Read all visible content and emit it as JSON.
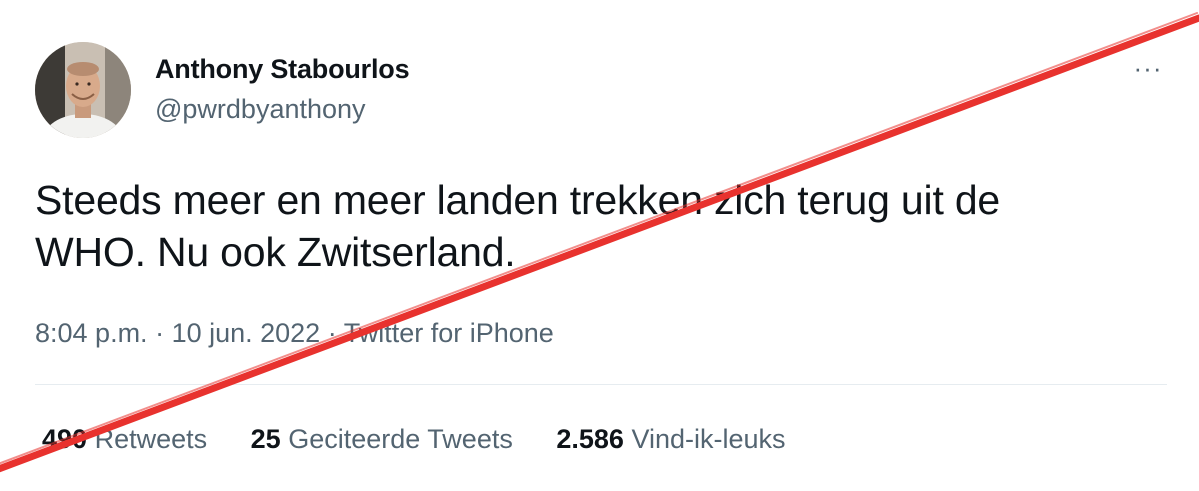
{
  "user": {
    "display_name": "Anthony Stabourlos",
    "handle": "@pwrdbyanthony"
  },
  "more_icon": "···",
  "tweet": {
    "text": "Steeds meer en meer landen trekken zich terug uit de\nWHO. Nu ook Zwitserland."
  },
  "meta": {
    "time": "8:04 p.m.",
    "separator": " · ",
    "date": "10 jun. 2022",
    "source": "Twitter for iPhone"
  },
  "stats": {
    "retweets_count": "490",
    "retweets_label": "Retweets",
    "quotes_count": "25",
    "quotes_label": "Geciteerde Tweets",
    "likes_count": "2.586",
    "likes_label": "Vind-ik-leuks"
  },
  "colors": {
    "strike": "#e8322e",
    "secondary_text": "#536471",
    "primary_text": "#0f1419"
  }
}
